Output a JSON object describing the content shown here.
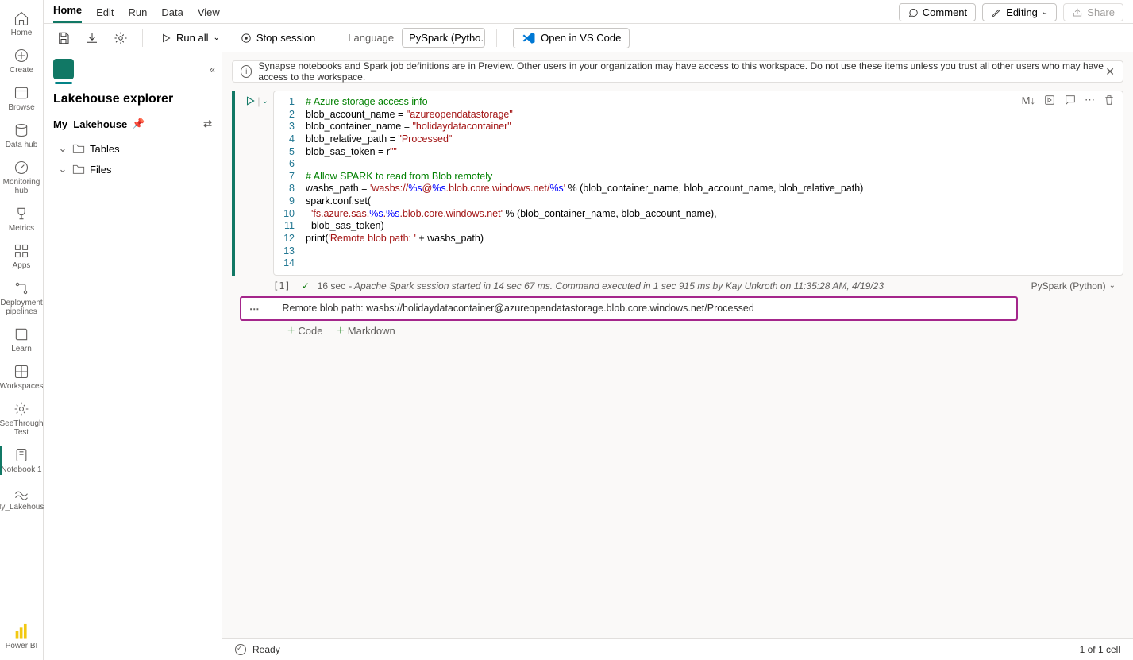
{
  "leftnav": {
    "items": [
      {
        "label": "Home"
      },
      {
        "label": "Create"
      },
      {
        "label": "Browse"
      },
      {
        "label": "Data hub"
      },
      {
        "label": "Monitoring hub"
      },
      {
        "label": "Metrics"
      },
      {
        "label": "Apps"
      },
      {
        "label": "Deployment pipelines"
      },
      {
        "label": "Learn"
      },
      {
        "label": "Workspaces"
      },
      {
        "label": "SeeThrough Test"
      },
      {
        "label": "Notebook 1"
      },
      {
        "label": "My_Lakehouse"
      }
    ],
    "footer": "Power BI"
  },
  "tabs": {
    "items": [
      {
        "label": "Home"
      },
      {
        "label": "Edit"
      },
      {
        "label": "Run"
      },
      {
        "label": "Data"
      },
      {
        "label": "View"
      }
    ],
    "right": {
      "comment": "Comment",
      "editing": "Editing",
      "share": "Share"
    }
  },
  "toolbar": {
    "run_all": "Run all",
    "stop_session": "Stop session",
    "language_label": "Language",
    "language_value": "PySpark (Pytho...",
    "open_vscode": "Open in VS Code"
  },
  "explorer": {
    "title": "Lakehouse explorer",
    "lakehouse": "My_Lakehouse",
    "tree": [
      {
        "label": "Tables"
      },
      {
        "label": "Files"
      }
    ]
  },
  "banner": {
    "text": "Synapse notebooks and Spark job definitions are in Preview. Other users in your organization may have access to this workspace. Do not use these items unless you trust all other users who may have access to the workspace."
  },
  "cell_toolbar": {
    "md_toggle": "M↓"
  },
  "code": {
    "lines": [
      {
        "n": "1",
        "segs": [
          {
            "t": "# Azure storage access info",
            "c": "c-com"
          }
        ]
      },
      {
        "n": "2",
        "segs": [
          {
            "t": "blob_account_name = ",
            "c": ""
          },
          {
            "t": "\"azureopendatastorage\"",
            "c": "c-str"
          }
        ]
      },
      {
        "n": "3",
        "segs": [
          {
            "t": "blob_container_name = ",
            "c": ""
          },
          {
            "t": "\"holidaydatacontainer\"",
            "c": "c-str"
          }
        ]
      },
      {
        "n": "4",
        "segs": [
          {
            "t": "blob_relative_path = ",
            "c": ""
          },
          {
            "t": "\"Processed\"",
            "c": "c-str"
          }
        ]
      },
      {
        "n": "5",
        "segs": [
          {
            "t": "blob_sas_token = r",
            "c": ""
          },
          {
            "t": "\"\"",
            "c": "c-str"
          }
        ]
      },
      {
        "n": "6",
        "segs": [
          {
            "t": "",
            "c": ""
          }
        ]
      },
      {
        "n": "7",
        "segs": [
          {
            "t": "# Allow SPARK to read from Blob remotely",
            "c": "c-com"
          }
        ]
      },
      {
        "n": "8",
        "segs": [
          {
            "t": "wasbs_path = ",
            "c": ""
          },
          {
            "t": "'wasbs://",
            "c": "c-str"
          },
          {
            "t": "%s",
            "c": "c-pct"
          },
          {
            "t": "@",
            "c": "c-str"
          },
          {
            "t": "%s",
            "c": "c-pct"
          },
          {
            "t": ".blob.core.windows.net/",
            "c": "c-str"
          },
          {
            "t": "%s",
            "c": "c-pct"
          },
          {
            "t": "'",
            "c": "c-str"
          },
          {
            "t": " % (blob_container_name, blob_account_name, blob_relative_path)",
            "c": ""
          }
        ]
      },
      {
        "n": "9",
        "segs": [
          {
            "t": "spark.conf.set(",
            "c": ""
          }
        ]
      },
      {
        "n": "10",
        "segs": [
          {
            "t": "  ",
            "c": ""
          },
          {
            "t": "'fs.azure.sas.",
            "c": "c-str"
          },
          {
            "t": "%s",
            "c": "c-pct"
          },
          {
            "t": ".",
            "c": "c-str"
          },
          {
            "t": "%s",
            "c": "c-pct"
          },
          {
            "t": ".blob.core.windows.net'",
            "c": "c-str"
          },
          {
            "t": " % (blob_container_name, blob_account_name),",
            "c": ""
          }
        ]
      },
      {
        "n": "11",
        "segs": [
          {
            "t": "  blob_sas_token)",
            "c": ""
          }
        ]
      },
      {
        "n": "12",
        "segs": [
          {
            "t": "print(",
            "c": ""
          },
          {
            "t": "'Remote blob path: '",
            "c": "c-str"
          },
          {
            "t": " + wasbs_path)",
            "c": ""
          }
        ]
      },
      {
        "n": "13",
        "segs": [
          {
            "t": "",
            "c": ""
          }
        ]
      },
      {
        "n": "14",
        "segs": [
          {
            "t": "",
            "c": ""
          }
        ]
      }
    ]
  },
  "exec": {
    "index": "[1]",
    "duration": "16 sec",
    "detail": "- Apache Spark session started in 14 sec 67 ms. Command executed in 1 sec 915 ms by Kay Unkroth on 11:35:28 AM, 4/19/23",
    "lang": "PySpark (Python)"
  },
  "output": {
    "text": "Remote blob path: wasbs://holidaydatacontainer@azureopendatastorage.blob.core.windows.net/Processed"
  },
  "add": {
    "code": "Code",
    "markdown": "Markdown"
  },
  "status": {
    "ready": "Ready",
    "cells": "1 of 1 cell"
  }
}
